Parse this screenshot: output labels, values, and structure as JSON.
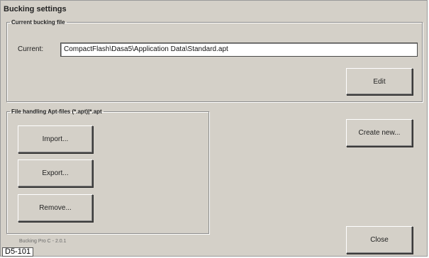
{
  "window": {
    "title": "Bucking settings"
  },
  "current_group": {
    "legend": "Current bucking file",
    "label": "Current:",
    "path_value": "CompactFlash\\Dasa5\\Application Data\\Standard.apt",
    "edit_label": "Edit"
  },
  "file_group": {
    "legend": "File handling Apt-files (*.apt)|*.apt",
    "import_label": "Import...",
    "export_label": "Export...",
    "remove_label": "Remove..."
  },
  "actions": {
    "create_new_label": "Create new...",
    "close_label": "Close"
  },
  "footer": {
    "version": "Bucking Pro C - 2.0.1",
    "figure_label": "D5-101"
  },
  "colors": {
    "window_bg": "#d4d0c8",
    "field_bg": "#ffffff"
  }
}
